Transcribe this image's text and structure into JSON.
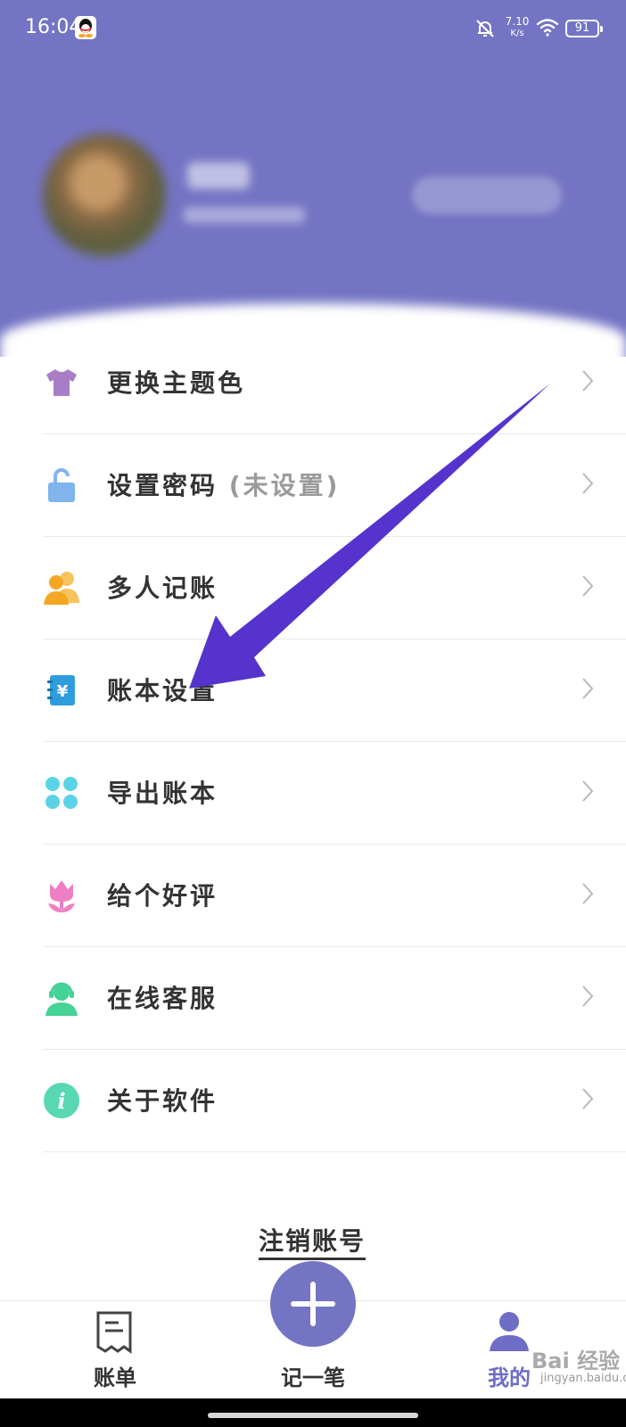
{
  "status_bar": {
    "time": "16:04",
    "network_speed": "7.10",
    "network_speed_unit": "K/s",
    "battery": "91"
  },
  "profile": {
    "nickname": "",
    "account_id": "",
    "action_label": ""
  },
  "menu": [
    {
      "label": "更换主题色",
      "note": "",
      "icon": "tshirt-icon",
      "color": "#a77dc8"
    },
    {
      "label": "设置密码",
      "note": "(未设置)",
      "icon": "unlock-icon",
      "color": "#7fb5ec"
    },
    {
      "label": "多人记账",
      "note": "",
      "icon": "users-icon",
      "color": "#f5a623"
    },
    {
      "label": "账本设置",
      "note": "",
      "icon": "ledger-icon",
      "color": "#2f9cdc"
    },
    {
      "label": "导出账本",
      "note": "",
      "icon": "clover-icon",
      "color": "#5ad3e6"
    },
    {
      "label": "给个好评",
      "note": "",
      "icon": "tulip-icon",
      "color": "#ee7fc4"
    },
    {
      "label": "在线客服",
      "note": "",
      "icon": "support-agent-icon",
      "color": "#45d296"
    },
    {
      "label": "关于软件",
      "note": "",
      "icon": "info-icon",
      "color": "#57d8b3"
    }
  ],
  "logout_label": "注销账号",
  "bottom_nav": {
    "bills_label": "账单",
    "record_label": "记一笔",
    "mine_label": "我的"
  },
  "watermark": {
    "logo": "Bai 经验",
    "url": "jingyan.baidu.com"
  },
  "colors": {
    "header": "#7474c4",
    "accent": "#6e6ec6",
    "annotation_arrow": "#5533cc"
  }
}
